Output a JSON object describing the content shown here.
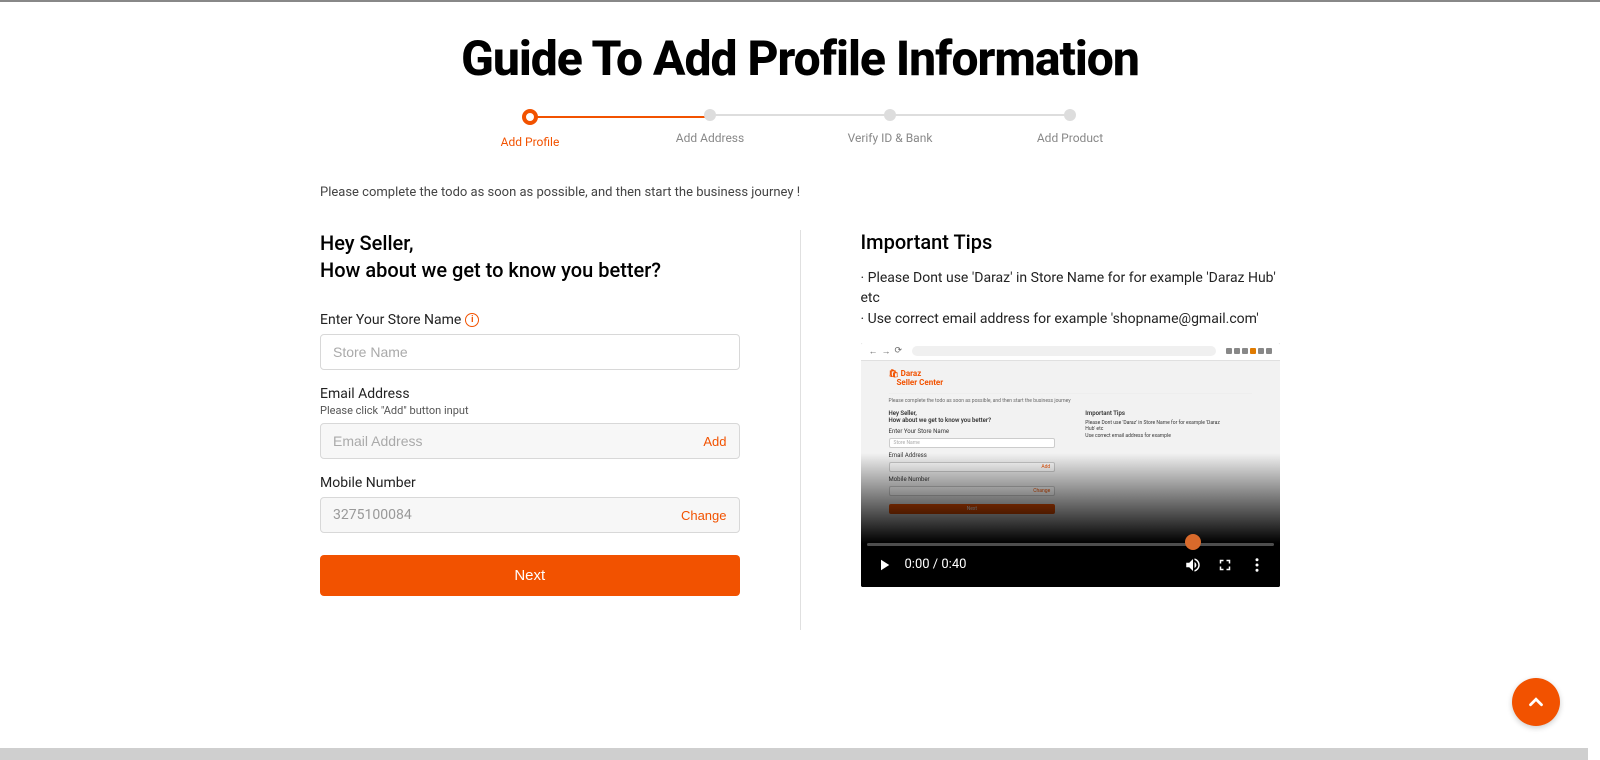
{
  "page": {
    "title": "Guide To Add Profile Information",
    "instruction": "Please complete the todo as soon as possible, and then start the business journey !"
  },
  "stepper": {
    "steps": [
      {
        "label": "Add Profile",
        "active": true
      },
      {
        "label": "Add Address",
        "active": false
      },
      {
        "label": "Verify ID & Bank",
        "active": false
      },
      {
        "label": "Add Product",
        "active": false
      }
    ]
  },
  "form": {
    "greeting_line1": "Hey Seller,",
    "greeting_line2": "How about we get to know you better?",
    "store_name_label": "Enter Your Store Name",
    "store_name_placeholder": "Store Name",
    "email_label": "Email Address",
    "email_hint": "Please click \"Add\" button input",
    "email_placeholder": "Email Address",
    "email_action": "Add",
    "mobile_label": "Mobile Number",
    "mobile_value": "3275100084",
    "mobile_action": "Change",
    "next_button": "Next"
  },
  "tips": {
    "title": "Important Tips",
    "item1": "· Please Dont use 'Daraz' in Store Name for for example 'Daraz Hub' etc",
    "item2": "· Use correct email address for example 'shopname@gmail.com'"
  },
  "video": {
    "time": "0:00 / 0:40",
    "mini": {
      "logo_line1": "Daraz",
      "logo_line2": "Seller Center",
      "greeting1": "Hey Seller,",
      "greeting2": "How about we get to know you better?",
      "store_label": "Enter Your Store Name",
      "store_placeholder": "Store Name",
      "email_label": "Email Address",
      "mobile_label": "Mobile Number",
      "change": "Change",
      "next": "Next",
      "tips_title": "Important Tips",
      "tips_line1": "Please Dont use 'Daraz' in Store Name for for example 'Daraz",
      "tips_line2": "Hub' etc",
      "tips_line3": "Use correct email address for example"
    }
  }
}
